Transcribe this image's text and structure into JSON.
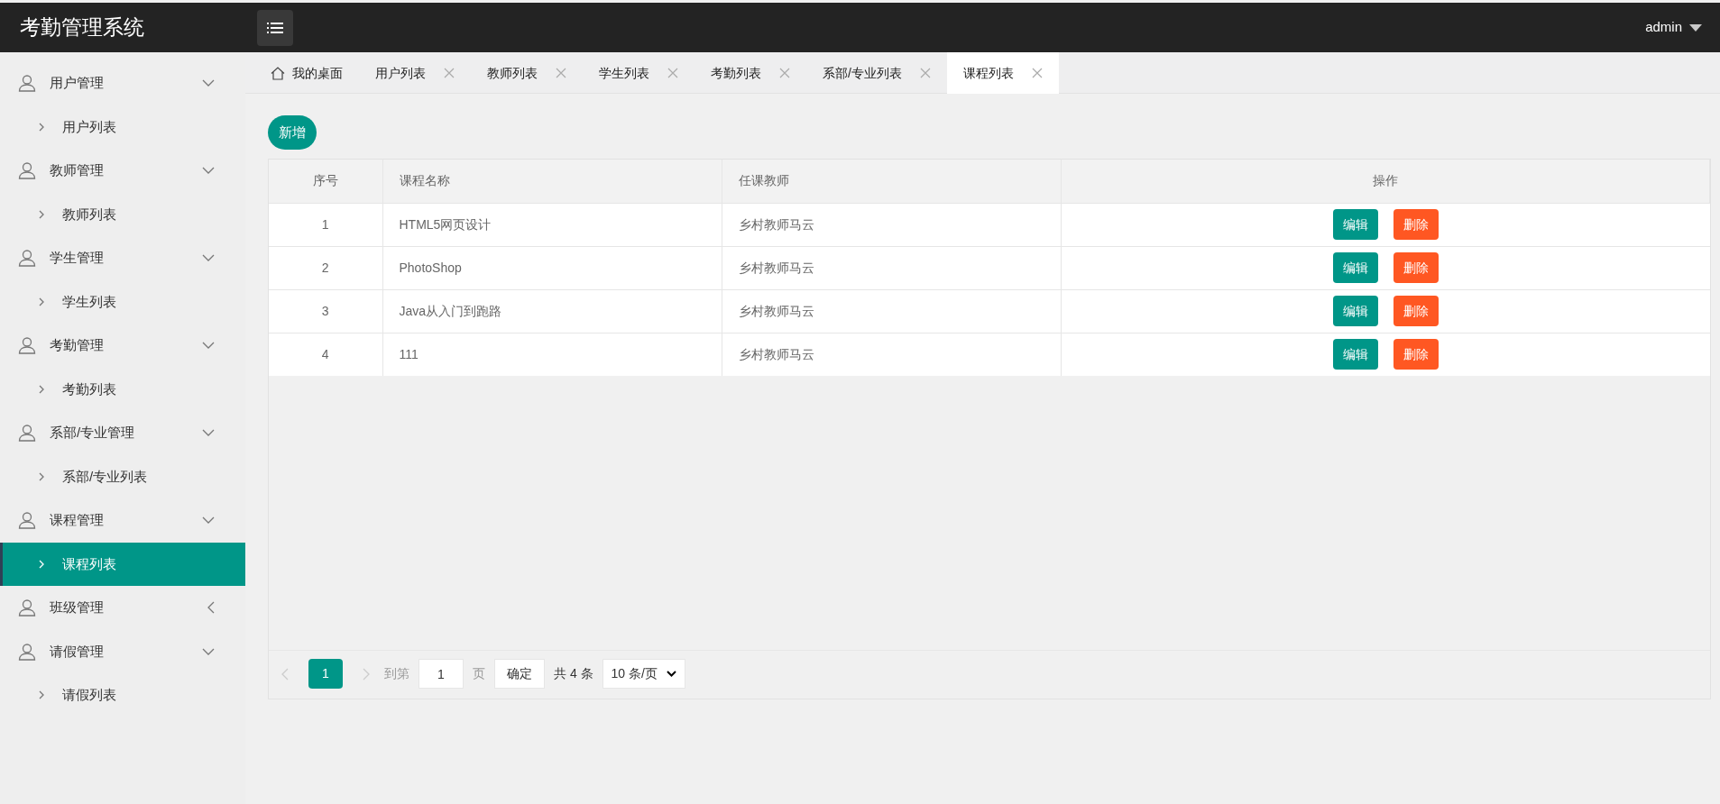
{
  "header": {
    "title": "考勤管理系统",
    "user": "admin"
  },
  "sidebar": {
    "groups": [
      {
        "label": "用户管理",
        "expanded": true,
        "children": [
          {
            "label": "用户列表",
            "selected": false
          }
        ]
      },
      {
        "label": "教师管理",
        "expanded": true,
        "children": [
          {
            "label": "教师列表",
            "selected": false
          }
        ]
      },
      {
        "label": "学生管理",
        "expanded": true,
        "children": [
          {
            "label": "学生列表",
            "selected": false
          }
        ]
      },
      {
        "label": "考勤管理",
        "expanded": true,
        "children": [
          {
            "label": "考勤列表",
            "selected": false
          }
        ]
      },
      {
        "label": "系部/专业管理",
        "expanded": true,
        "children": [
          {
            "label": "系部/专业列表",
            "selected": false
          }
        ]
      },
      {
        "label": "课程管理",
        "expanded": true,
        "children": [
          {
            "label": "课程列表",
            "selected": true
          }
        ]
      },
      {
        "label": "班级管理",
        "expanded": false
      },
      {
        "label": "请假管理",
        "expanded": true,
        "children": [
          {
            "label": "请假列表",
            "selected": false
          }
        ]
      }
    ]
  },
  "tabs": [
    {
      "label": "我的桌面",
      "kind": "home",
      "selected": false
    },
    {
      "label": "用户列表",
      "kind": "closable",
      "selected": false
    },
    {
      "label": "教师列表",
      "kind": "closable",
      "selected": false
    },
    {
      "label": "学生列表",
      "kind": "closable",
      "selected": false
    },
    {
      "label": "考勤列表",
      "kind": "closable",
      "selected": false
    },
    {
      "label": "系部/专业列表",
      "kind": "closable",
      "selected": false
    },
    {
      "label": "课程列表",
      "kind": "closable",
      "selected": true
    }
  ],
  "add_button": "新增",
  "table": {
    "columns": [
      "序号",
      "课程名称",
      "任课教师",
      "操作"
    ],
    "rows": [
      {
        "cells": [
          "1",
          "HTML5网页设计",
          "乡村教师马云"
        ],
        "actions": [
          "编辑",
          "删除"
        ]
      },
      {
        "cells": [
          "2",
          "PhotoShop",
          "乡村教师马云"
        ],
        "actions": [
          "编辑",
          "删除"
        ]
      },
      {
        "cells": [
          "3",
          "Java从入门到跑路",
          "乡村教师马云"
        ],
        "actions": [
          "编辑",
          "删除"
        ]
      },
      {
        "cells": [
          "4",
          "111",
          "乡村教师马云"
        ],
        "actions": [
          "编辑",
          "删除"
        ]
      }
    ]
  },
  "pagination": {
    "pages": [
      {
        "label": "1",
        "selected": true
      }
    ],
    "goto_label": "到第",
    "goto_value": "1",
    "page_unit": "页",
    "confirm": "确定",
    "total": "共 4 条",
    "page_size": "10 条/页"
  }
}
